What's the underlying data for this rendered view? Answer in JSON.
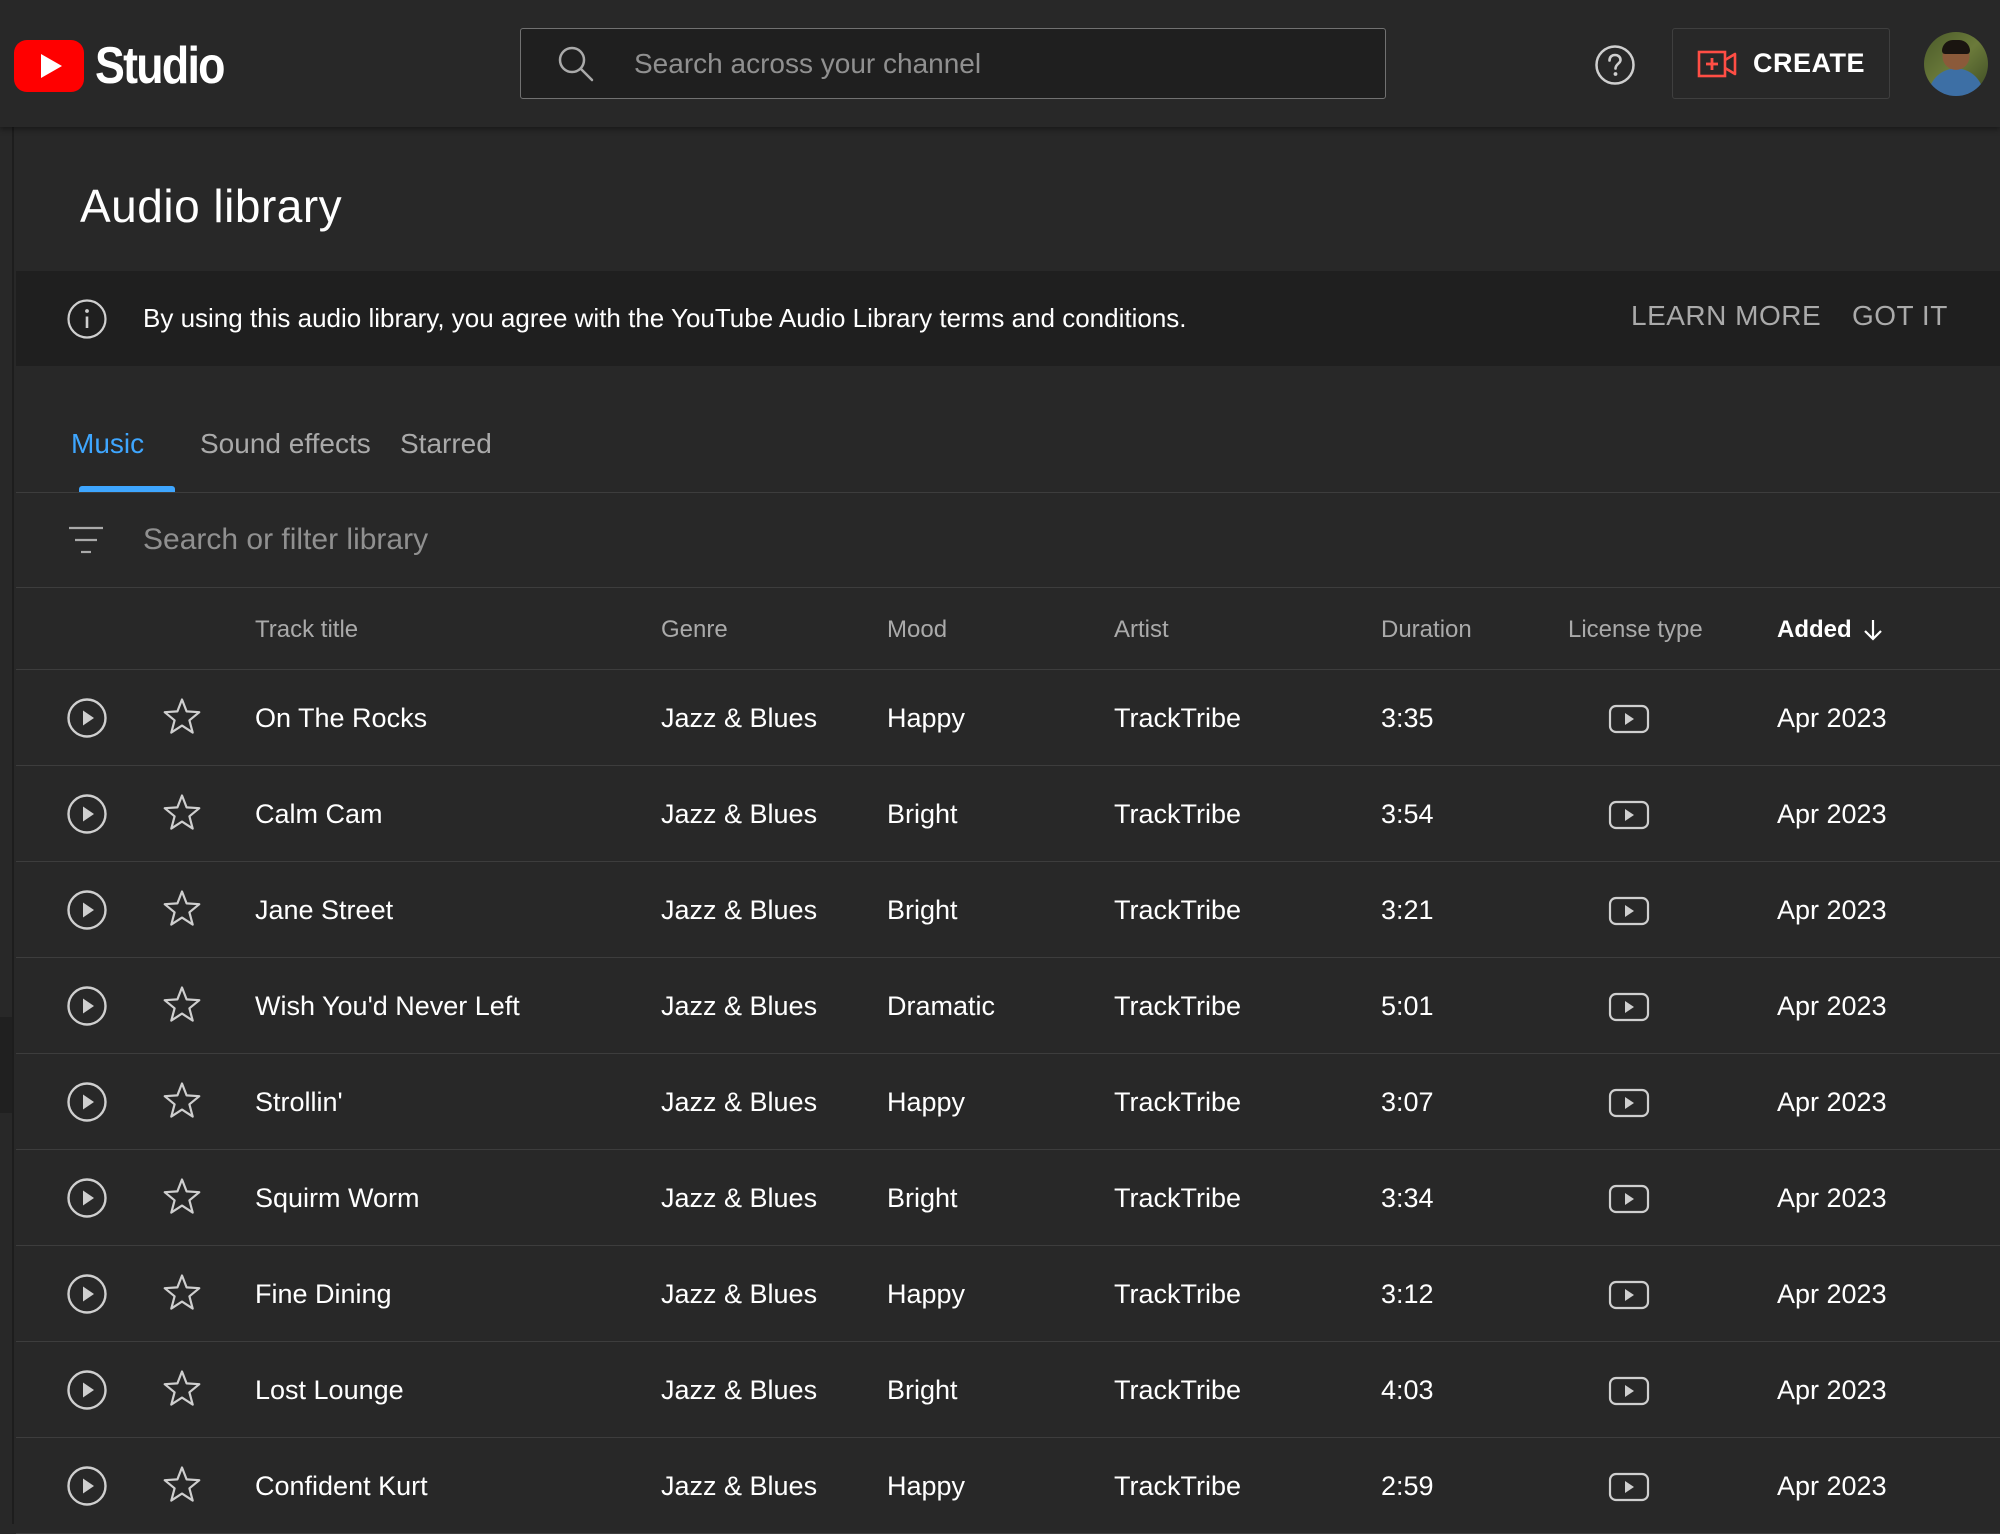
{
  "header": {
    "logo_text": "Studio",
    "search_placeholder": "Search across your channel",
    "create_label": "CREATE"
  },
  "page": {
    "title": "Audio library"
  },
  "banner": {
    "text": "By using this audio library, you agree with the YouTube Audio Library terms and conditions.",
    "learn_more": "LEARN MORE",
    "got_it": "GOT IT"
  },
  "tabs": [
    {
      "label": "Music",
      "active": true
    },
    {
      "label": "Sound effects",
      "active": false
    },
    {
      "label": "Starred",
      "active": false
    }
  ],
  "filter": {
    "placeholder": "Search or filter library"
  },
  "columns": {
    "title": "Track title",
    "genre": "Genre",
    "mood": "Mood",
    "artist": "Artist",
    "duration": "Duration",
    "license": "License type",
    "added": "Added"
  },
  "tracks": [
    {
      "title": "On The Rocks",
      "genre": "Jazz & Blues",
      "mood": "Happy",
      "artist": "TrackTribe",
      "duration": "3:35",
      "added": "Apr 2023"
    },
    {
      "title": "Calm Cam",
      "genre": "Jazz & Blues",
      "mood": "Bright",
      "artist": "TrackTribe",
      "duration": "3:54",
      "added": "Apr 2023"
    },
    {
      "title": "Jane Street",
      "genre": "Jazz & Blues",
      "mood": "Bright",
      "artist": "TrackTribe",
      "duration": "3:21",
      "added": "Apr 2023"
    },
    {
      "title": "Wish You'd Never Left",
      "genre": "Jazz & Blues",
      "mood": "Dramatic",
      "artist": "TrackTribe",
      "duration": "5:01",
      "added": "Apr 2023"
    },
    {
      "title": "Strollin'",
      "genre": "Jazz & Blues",
      "mood": "Happy",
      "artist": "TrackTribe",
      "duration": "3:07",
      "added": "Apr 2023"
    },
    {
      "title": "Squirm Worm",
      "genre": "Jazz & Blues",
      "mood": "Bright",
      "artist": "TrackTribe",
      "duration": "3:34",
      "added": "Apr 2023"
    },
    {
      "title": "Fine Dining",
      "genre": "Jazz & Blues",
      "mood": "Happy",
      "artist": "TrackTribe",
      "duration": "3:12",
      "added": "Apr 2023"
    },
    {
      "title": "Lost Lounge",
      "genre": "Jazz & Blues",
      "mood": "Bright",
      "artist": "TrackTribe",
      "duration": "4:03",
      "added": "Apr 2023"
    },
    {
      "title": "Confident Kurt",
      "genre": "Jazz & Blues",
      "mood": "Happy",
      "artist": "TrackTribe",
      "duration": "2:59",
      "added": "Apr 2023"
    }
  ],
  "icons": {
    "logo": "youtube-logo-icon",
    "search": "search-icon",
    "help": "help-icon",
    "create": "video-plus-icon",
    "info": "info-icon",
    "filter": "filter-icon",
    "sort": "arrow-down-icon",
    "play": "play-circle-icon",
    "star": "star-outline-icon",
    "license": "youtube-license-icon"
  },
  "colors": {
    "background": "#282828",
    "banner": "#1f1f1f",
    "accent": "#3ea6ff",
    "brand": "#ff0000",
    "muted_text": "#aaaaaa"
  }
}
